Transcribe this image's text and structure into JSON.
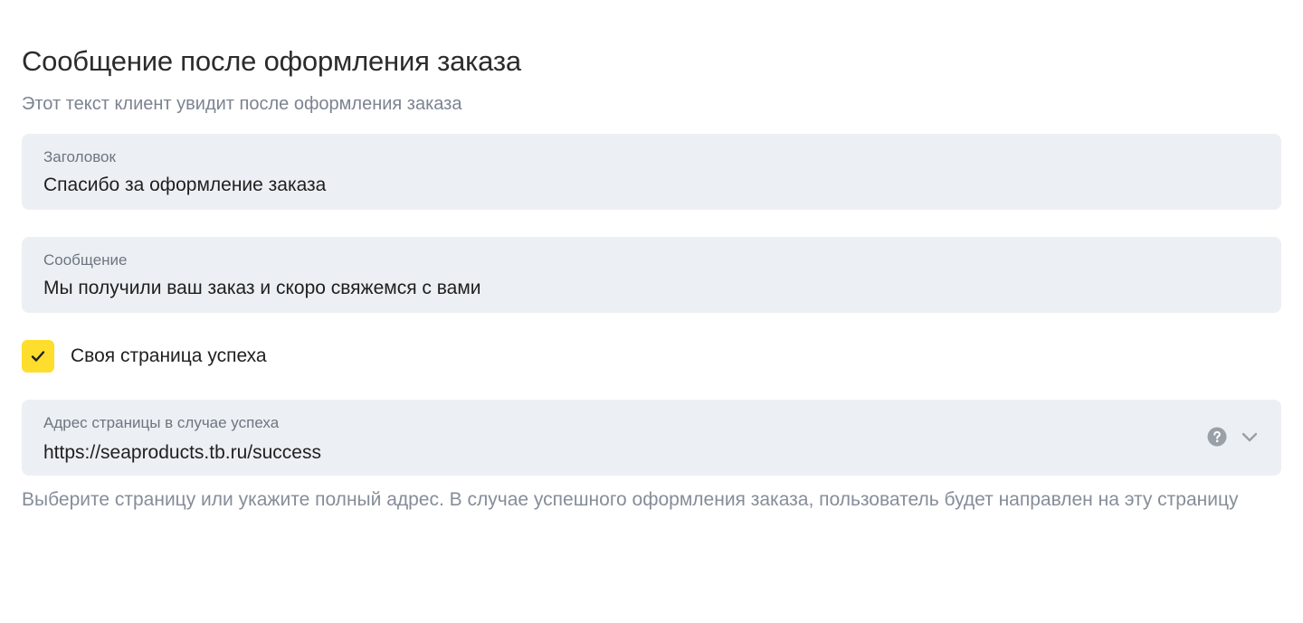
{
  "section": {
    "title": "Сообщение после оформления заказа",
    "subtitle": "Этот текст клиент увидит после оформления заказа"
  },
  "fields": {
    "title_field": {
      "label": "Заголовок",
      "value": "Спасибо за оформление заказа"
    },
    "message_field": {
      "label": "Сообщение",
      "value": "Мы получили ваш заказ и скоро свяжемся с вами"
    },
    "custom_success_page": {
      "label": "Своя страница успеха",
      "checked": true
    },
    "success_url_field": {
      "label": "Адрес страницы в случае успеха",
      "value": "https://seaproducts.tb.ru/success",
      "hint": "Выберите страницу или укажите полный адрес. В случае успешного оформления заказа, пользователь будет направлен на эту страницу"
    }
  },
  "icons": {
    "checkbox": "checkmark-icon",
    "help": "question-circle-icon",
    "dropdown": "chevron-down-icon"
  },
  "colors": {
    "accent": "#ffdd2d",
    "field_background": "#ecf0f4",
    "muted_text": "#7c8390",
    "icon": "#9aa0a8"
  }
}
